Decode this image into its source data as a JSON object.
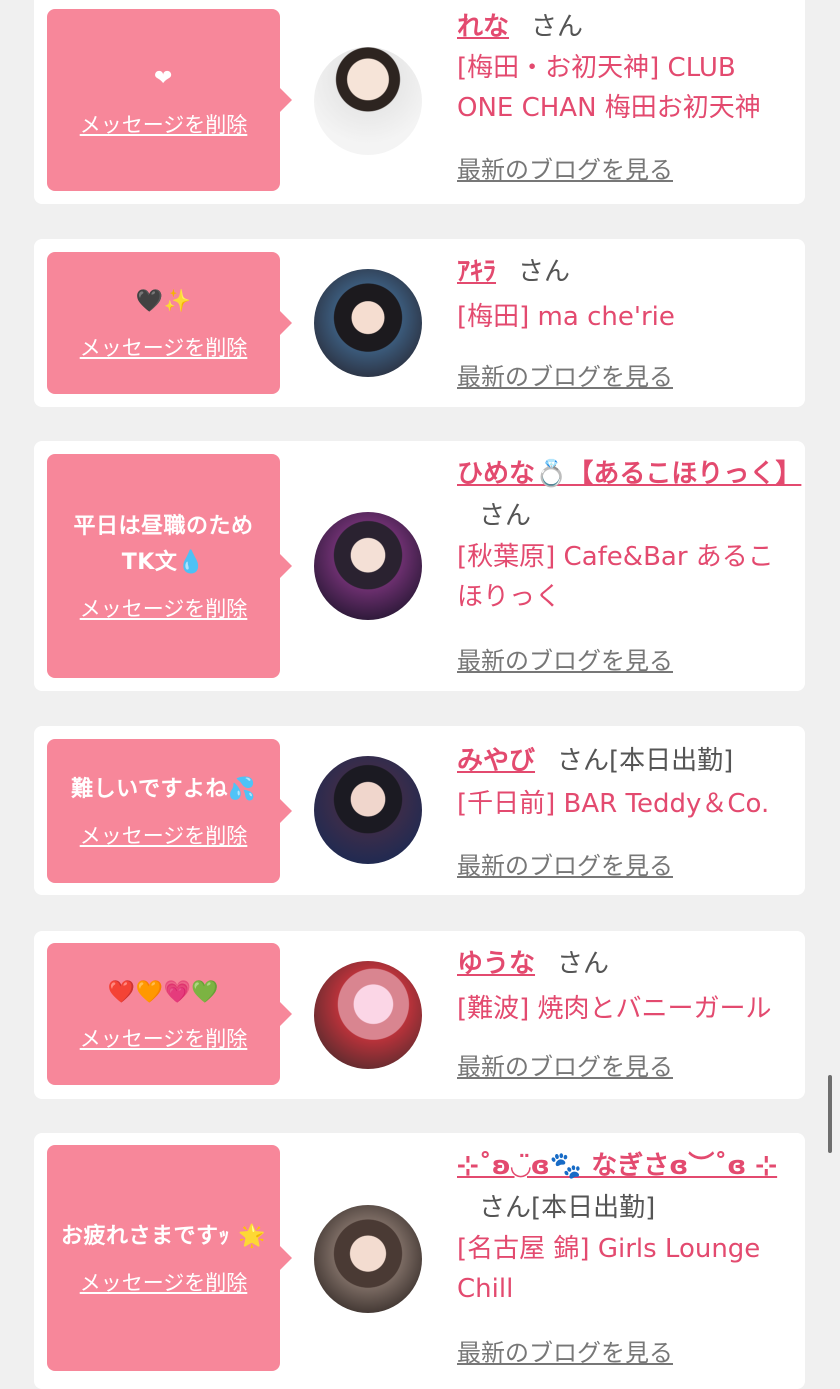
{
  "delete_label": "メッセージを削除",
  "blog_label": "最新のブログを見る",
  "san_label": "さん",
  "colors": {
    "accent": "#e34a6f",
    "bubble": "#f7879a",
    "background": "#f0f0f0"
  },
  "cards": [
    {
      "message": "❤",
      "name": "れな",
      "status": "",
      "shop": "[梅田・お初天神] CLUB ONE CHAN 梅田お初天神"
    },
    {
      "message": "🖤✨",
      "name": "ｱｷﾗ",
      "status": "",
      "shop": "[梅田] ma che'rie"
    },
    {
      "message": "平日は昼職のため TK文💧",
      "name": "ひめな💍【あるこほりっく】",
      "status": "",
      "shop": "[秋葉原] Cafe&Bar あるこほりっく"
    },
    {
      "message": "難しいですよね💦",
      "name": "みやび",
      "status": "[本日出勤]",
      "shop": "[千日前] BAR Teddy＆Co."
    },
    {
      "message": "❤️🧡💗💚",
      "name": "ゆうな",
      "status": "",
      "shop": "[難波] 焼肉とバニーガール"
    },
    {
      "message": "お疲れさまですｯ 🌟",
      "name": "⊹˚ʚ◡̈⁠ɞ🐾 なぎさɞ︶˚ɞ ⊹",
      "status": "[本日出勤]",
      "shop": "[名古屋 錦] Girls Lounge Chill"
    }
  ]
}
